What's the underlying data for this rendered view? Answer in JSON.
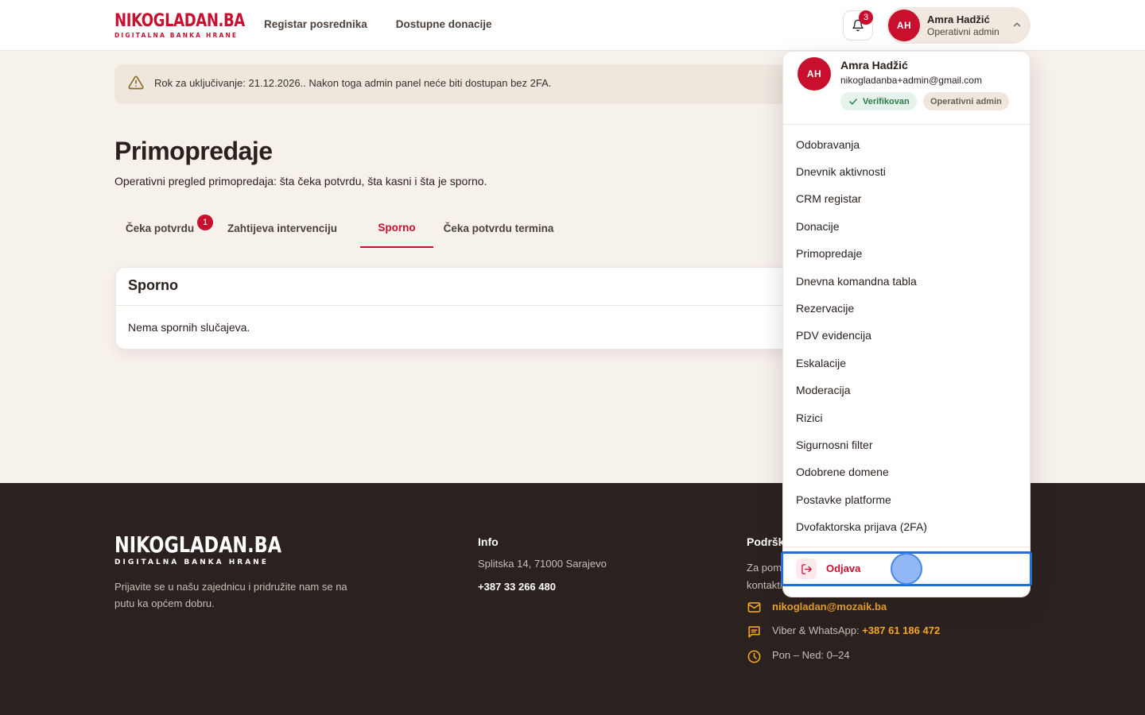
{
  "header": {
    "logo_main": "NIKOGLADAN.BA",
    "logo_sub": "DIGITALNA BANKA HRANE",
    "nav": [
      "Registar posrednika",
      "Dostupne donacije"
    ],
    "notifications_count": "3",
    "user_initials": "AH",
    "user_name": "Amra Hadžić",
    "user_role": "Operativni admin"
  },
  "alert": {
    "text": "Rok za uključivanje: 21.12.2026.. Nakon toga admin panel neće biti dostupan bez 2FA."
  },
  "page": {
    "title": "Primopredaje",
    "subtitle": "Operativni pregled primopredaja: šta čeka potvrdu, šta kasni i šta je sporno."
  },
  "tabs": [
    {
      "label": "Čeka potvrdu",
      "badge": "1"
    },
    {
      "label": "Zahtijeva intervenciju"
    },
    {
      "label": "Sporno",
      "active": true
    },
    {
      "label": "Čeka potvrdu termina"
    }
  ],
  "card": {
    "title": "Sporno",
    "empty_text": "Nema spornih slučajeva."
  },
  "footer": {
    "logo_main": "NIKOGLADAN.BA",
    "logo_sub": "DIGITALNA BANKA HRANE",
    "tagline": "Prijavite se u našu zajednicu i pridružite nam se na putu ka općem dobru.",
    "info_heading": "Info",
    "address": "Splitska 14, 71000 Sarajevo",
    "phone": "+387 33 266 480",
    "support_heading": "Podrška",
    "support_text": "Za pomoć kontaktirajte nas:",
    "email": "nikogladan@mozaik.ba",
    "viber_label": "Viber & WhatsApp:",
    "viber_number": "+387 61 186 472",
    "hours": "Pon – Ned: 0–24"
  },
  "dropdown": {
    "initials": "AH",
    "name": "Amra Hadžić",
    "email": "nikogladanba+admin@gmail.com",
    "verified": "Verifikovan",
    "role": "Operativni admin",
    "items": [
      "Odobravanja",
      "Dnevnik aktivnosti",
      "CRM registar",
      "Donacije",
      "Primopredaje",
      "Dnevna komandna tabla",
      "Rezervacije",
      "PDV evidencija",
      "Eskalacije",
      "Moderacija",
      "Rizici",
      "Sigurnosni filter",
      "Odobrene domene",
      "Postavke platforme",
      "Dvofaktorska prijava (2FA)"
    ],
    "logout": "Odjava"
  },
  "colors": {
    "brand_red": "#c8102e",
    "footer_bg": "#2b211e",
    "accent_orange": "#f5a623",
    "focus_blue": "#1f6fe0"
  }
}
